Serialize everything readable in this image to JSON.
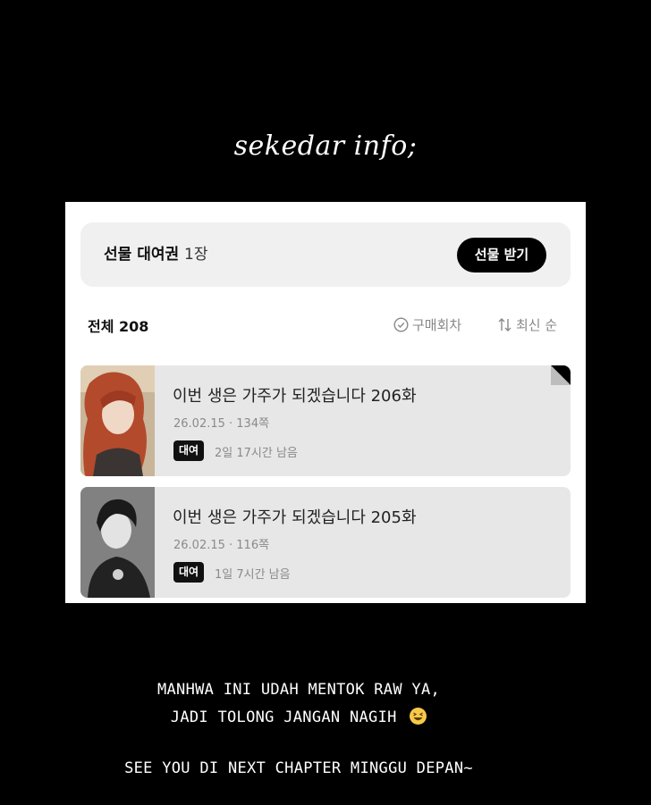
{
  "heading": "sekedar info;",
  "gift": {
    "label": "선물 대여권",
    "count": "1장",
    "button": "선물 받기"
  },
  "list": {
    "total": "전체 208",
    "purchased_filter": "구매회차",
    "sort": "최신 순"
  },
  "episodes": [
    {
      "title": "이번 생은 가주가 되겠습니다 206화",
      "meta": "26.02.15 · 134쪽",
      "badge": "대여",
      "remaining": "2일 17시간 남음"
    },
    {
      "title": "이번 생은 가주가 되겠습니다 205화",
      "meta": "26.02.15 · 116쪽",
      "badge": "대여",
      "remaining": "1일 7시간 남음"
    }
  ],
  "captions": {
    "line1": "MANHWA INI UDAH MENTOK RAW YA,",
    "line2": "JADI TOLONG JANGAN NAGIH",
    "line3": "SEE YOU DI NEXT CHAPTER MINGGU DEPAN~"
  },
  "icons": {
    "purchased": "check-circle-icon",
    "sort": "sort-arrows-icon",
    "emoji": "grinning-squinting-face-emoji"
  }
}
